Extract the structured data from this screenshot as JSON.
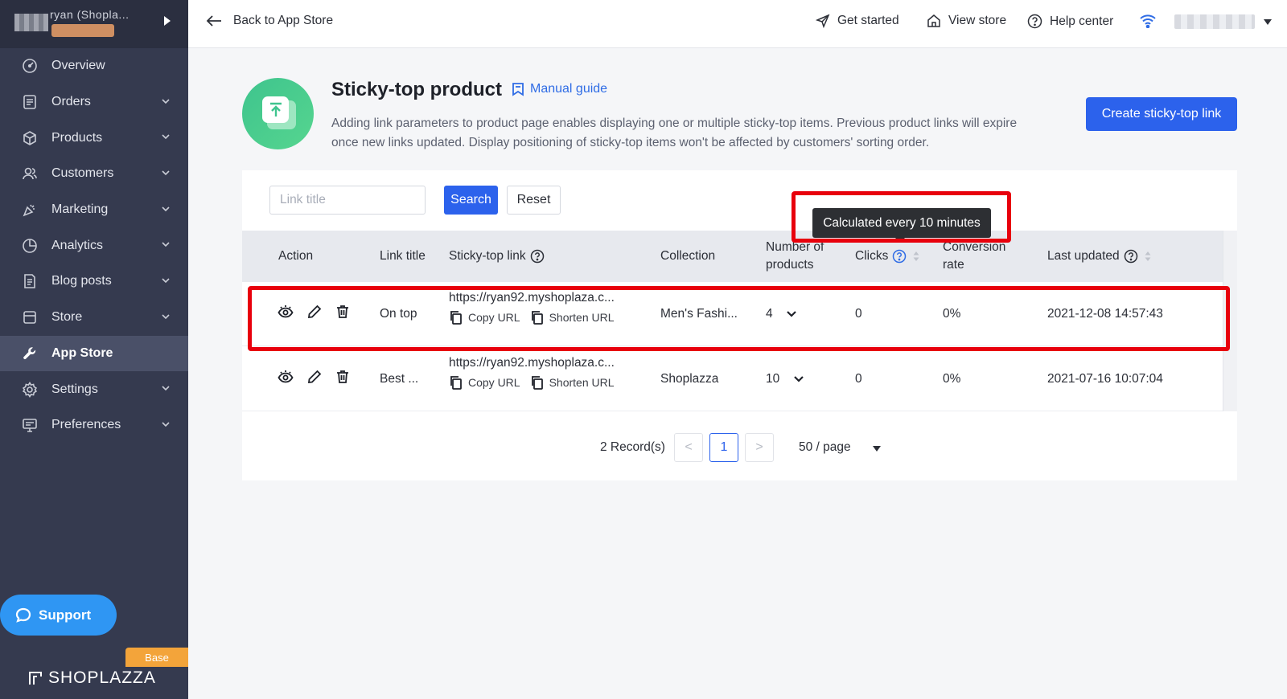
{
  "sidebar": {
    "store_name": "ryan (Shopla...",
    "items": [
      {
        "label": "Overview",
        "icon": "dashboard-icon",
        "has_chevron": false
      },
      {
        "label": "Orders",
        "icon": "orders-icon",
        "has_chevron": true
      },
      {
        "label": "Products",
        "icon": "box-icon",
        "has_chevron": true
      },
      {
        "label": "Customers",
        "icon": "users-icon",
        "has_chevron": true
      },
      {
        "label": "Marketing",
        "icon": "megaphone-icon",
        "has_chevron": true
      },
      {
        "label": "Analytics",
        "icon": "pie-chart-icon",
        "has_chevron": true
      },
      {
        "label": "Blog posts",
        "icon": "document-icon",
        "has_chevron": true
      },
      {
        "label": "Store",
        "icon": "storefront-icon",
        "has_chevron": true
      },
      {
        "label": "App Store",
        "icon": "wrench-icon",
        "has_chevron": false,
        "active": true
      },
      {
        "label": "Settings",
        "icon": "gear-icon",
        "has_chevron": true
      },
      {
        "label": "Preferences",
        "icon": "monitor-icon",
        "has_chevron": true
      }
    ],
    "support_label": "Support",
    "plan_badge": "Base",
    "brand": "SHOPLAZZA"
  },
  "topbar": {
    "back_label": "Back to App Store",
    "get_started": "Get started",
    "view_store": "View store",
    "help_center": "Help center"
  },
  "header": {
    "title": "Sticky-top product",
    "manual_guide": "Manual guide",
    "description": "Adding link parameters to product page enables displaying one or multiple sticky-top items. Previous product links will expire once new links updated. Display positioning of sticky-top items won't be affected by customers' sorting order.",
    "create_button": "Create sticky-top link"
  },
  "filters": {
    "link_title_placeholder": "Link title",
    "search_label": "Search",
    "reset_label": "Reset"
  },
  "table": {
    "columns": {
      "action": "Action",
      "link_title": "Link title",
      "sticky_link": "Sticky-top link",
      "collection": "Collection",
      "num_products_line1": "Number of",
      "num_products_line2": "products",
      "clicks": "Clicks",
      "conversion_line1": "Conversion",
      "conversion_line2": "rate",
      "last_updated": "Last updated"
    },
    "copy_url_label": "Copy URL",
    "shorten_url_label": "Shorten URL",
    "rows": [
      {
        "title": "On top",
        "link": "https://ryan92.myshoplaza.c...",
        "collection": "Men's Fashi...",
        "products": "4",
        "clicks": "0",
        "conversion": "0%",
        "updated": "2021-12-08 14:57:43"
      },
      {
        "title": "Best ...",
        "link": "https://ryan92.myshoplaza.c...",
        "collection": "Shoplazza",
        "products": "10",
        "clicks": "0",
        "conversion": "0%",
        "updated": "2021-07-16 10:07:04"
      }
    ]
  },
  "pagination": {
    "records": "2 Record(s)",
    "prev": "<",
    "current_page": "1",
    "next": ">",
    "page_size": "50 / page"
  },
  "tooltip": {
    "text": "Calculated every 10 minutes"
  },
  "colors": {
    "accent": "#2c62ec",
    "sidebar_bg": "#353a4f",
    "highlight": "#e8000c",
    "app_icon": "#3ec48e"
  }
}
